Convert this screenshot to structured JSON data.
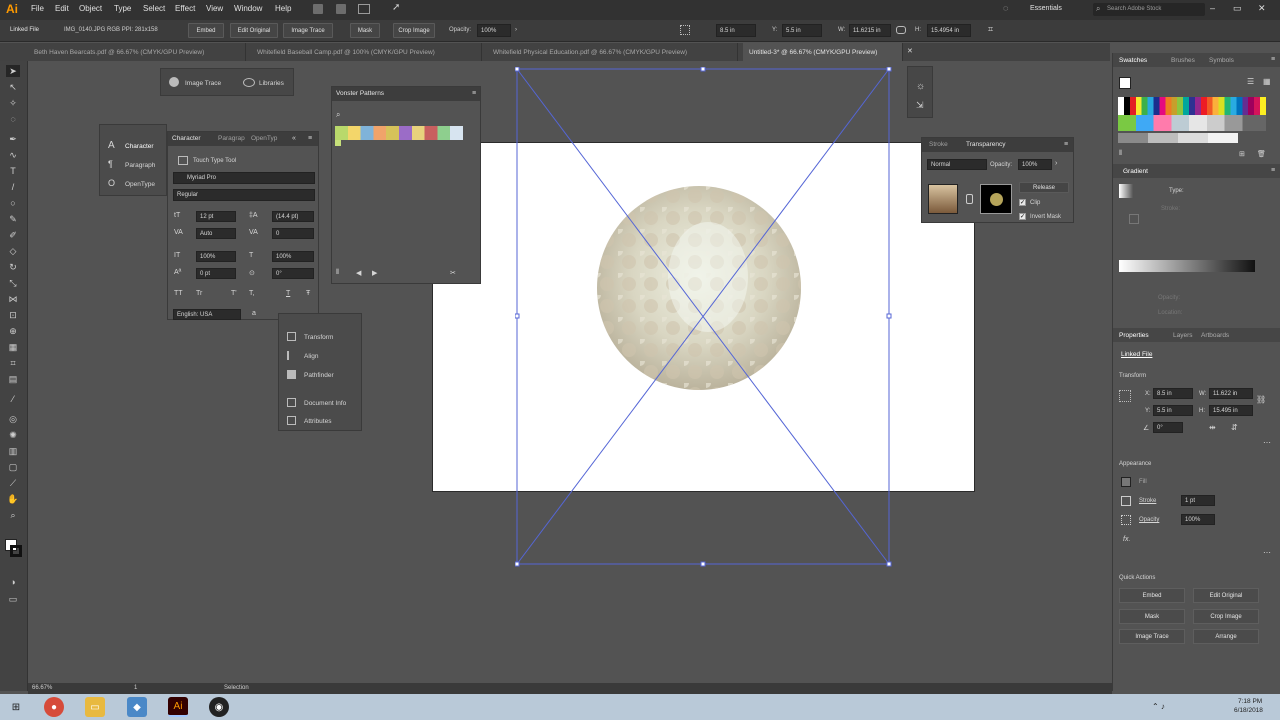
{
  "app": {
    "logo": "Ai",
    "workspace": "Essentials",
    "search_placeholder": "Search Adobe Stock"
  },
  "menu": [
    "File",
    "Edit",
    "Object",
    "Type",
    "Select",
    "Effect",
    "View",
    "Window",
    "Help"
  ],
  "control": {
    "object_type": "Linked File",
    "file_info": "IMG_0140.JPG  RGB  PPI: 281x158",
    "embed": "Embed",
    "edit_original": "Edit Original",
    "image_trace": "Image Trace",
    "mask": "Mask",
    "crop_image": "Crop Image",
    "opacity_label": "Opacity:",
    "opacity_value": "100%",
    "x_value": "8.5 in",
    "y_label": "Y:",
    "y_value": "5.5 in",
    "w_label": "W:",
    "w_value": "11.6215 in",
    "h_label": "H:",
    "h_value": "15.4954 in"
  },
  "tabs": [
    "Beth Haven Bearcats.pdf @ 66.67% (CMYK/GPU Preview)",
    "Whitefield Baseball Camp.pdf @ 100% (CMYK/GPU Preview)",
    "Whitefield Physical Education.pdf @ 66.67% (CMYK/GPU Preview)",
    "Untitled-3* @ 66.67% (CMYK/GPU Preview)"
  ],
  "image_trace_panel": {
    "image_trace": "Image Trace",
    "libraries": "Libraries"
  },
  "vonster_panel": {
    "title": "Vonster Patterns"
  },
  "char_left": {
    "items": [
      "Character",
      "Paragraph",
      "OpenType"
    ]
  },
  "character_panel": {
    "tabs": [
      "Character",
      "Paragrap",
      "OpenTyp"
    ],
    "touch_type": "Touch Type Tool",
    "font": "Myriad Pro",
    "style": "Regular",
    "size": "12 pt",
    "leading": "(14.4 pt)",
    "kerning": "Auto",
    "tracking": "0",
    "vscale": "100%",
    "hscale": "100%",
    "baseline": "0 pt",
    "rotation": "0°",
    "tt_buttons": [
      "TT",
      "Tr",
      "T'",
      "T,",
      "T",
      "Ŧ"
    ],
    "language": "English: USA",
    "aa": "a"
  },
  "small_panel": {
    "items": [
      "Transform",
      "Align",
      "Pathfinder",
      "Document Info",
      "Attributes"
    ]
  },
  "transparency_panel": {
    "tabs": [
      "Stroke",
      "Transparency"
    ],
    "mode": "Normal",
    "opacity_label": "Opacity:",
    "opacity": "100%",
    "release": "Release",
    "clip": "Clip",
    "invert_mask": "Invert Mask"
  },
  "swatches_tabs": [
    "Swatches",
    "Brushes",
    "Symbols"
  ],
  "gradient": {
    "title": "Gradient",
    "type_label": "Type:",
    "stroke_label": "Stroke:",
    "opacity_label": "Opacity:",
    "location_label": "Location:"
  },
  "properties": {
    "tabs": [
      "Properties",
      "Layers",
      "Artboards"
    ],
    "linked_file": "Linked File",
    "transform": "Transform",
    "x_label": "X:",
    "x": "8.5 in",
    "y_label": "Y:",
    "y": "5.5 in",
    "w_label": "W:",
    "w": "11.622 in",
    "h_label": "H:",
    "h": "15.495 in",
    "angle": "0°",
    "appearance": "Appearance",
    "fill": "Fill",
    "stroke": "Stroke",
    "stroke_weight": "1 pt",
    "opacity": "Opacity",
    "opacity_value": "100%",
    "fx": "fx.",
    "quick_actions": "Quick Actions",
    "embed": "Embed",
    "edit_original": "Edit Original",
    "mask": "Mask",
    "crop_image": "Crop Image",
    "image_trace": "Image Trace",
    "arrange": "Arrange"
  },
  "status": {
    "zoom": "66.67%",
    "artboard": "1",
    "tool": "Selection"
  },
  "taskbar": {
    "time": "7:18 PM",
    "date": "6/18/2018"
  },
  "colors": {
    "accent": "#5566d6",
    "chrome": "#323232",
    "panel": "#535353"
  }
}
